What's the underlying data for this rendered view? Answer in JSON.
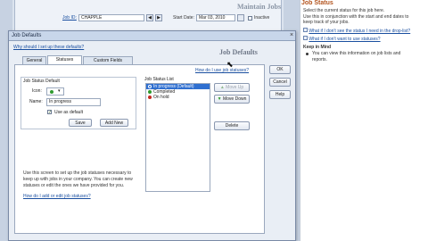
{
  "background": {
    "title": "Maintain Jobs",
    "job_id_label": "Job ID:",
    "job_id_value": "CHAPPLE",
    "start_date_label": "Start Date:",
    "start_date_value": "Mar 03, 2010",
    "inactive_label": "Inactive"
  },
  "help": {
    "title": "Job Status",
    "intro": [
      "Select the current status for this job here.",
      "Use this in conjunction with the start and end dates to",
      "keep track of your jobs."
    ],
    "questions": [
      "What if I don't see the status I need in the drop-list?",
      "What if I don't want to use statuses?"
    ],
    "keep_in_mind": "Keep in Mind",
    "bullet": [
      "You can view this information on job lists and",
      "reports."
    ]
  },
  "dialog": {
    "title": "Job Defaults",
    "heading": "Job Defaults",
    "why_link": "Why should I set up these defaults?",
    "tabs": [
      "General",
      "Statuses",
      "Custom Fields"
    ],
    "selected_tab": 1,
    "how_link": "How do I use job statuses?",
    "buttons": {
      "ok": "OK",
      "cancel": "Cancel",
      "help": "Help"
    },
    "status_defaults": {
      "group_label": "Job Status Default",
      "icon_label": "Icon:",
      "name_label": "Name:",
      "name_value": "In progress",
      "use_default_label": "Use as default",
      "save_label": "Save",
      "add_new_label": "Add New"
    },
    "status_list": {
      "label": "Job Status List",
      "items": [
        {
          "label": "In progress (Default)",
          "color": "#2e6fd1",
          "selected": true
        },
        {
          "label": "Completed",
          "color": "#2f9a2f",
          "selected": false
        },
        {
          "label": "On hold",
          "color": "#c42a22",
          "selected": false
        }
      ],
      "move_up_label": "Move Up",
      "move_down_label": "Move Down",
      "delete_label": "Delete"
    },
    "info_text": [
      "Use this screen to set up the job statuses necessary to",
      "keep up with jobs in your company. You can create new",
      "statuses or edit the ones we have provided for you."
    ],
    "edit_link": "How do I add or edit job statuses?"
  },
  "colors": {
    "help_title": "#b3541e",
    "selection": "#2f6fd0",
    "link": "#1a4fa0"
  }
}
